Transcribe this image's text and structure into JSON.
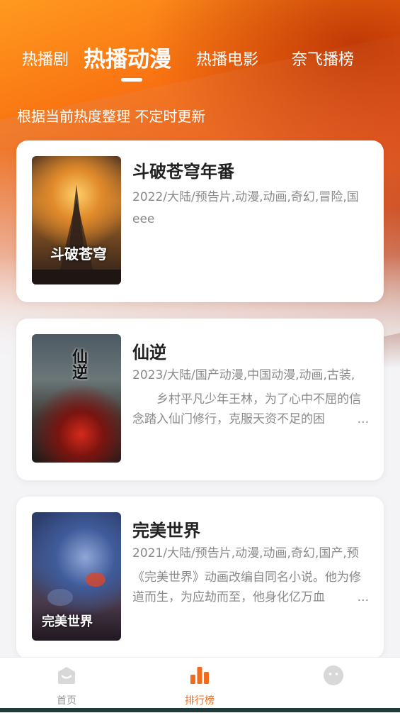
{
  "tabs": [
    {
      "label": "热播剧",
      "active": false
    },
    {
      "label": "热播动漫",
      "active": true
    },
    {
      "label": "热播电影",
      "active": false
    },
    {
      "label": "奈飞播榜",
      "active": false
    }
  ],
  "subtitle": "根据当前热度整理 不定时更新",
  "cards": [
    {
      "title": "斗破苍穹年番",
      "meta": "2022/大陆/预告片,动漫,动画,奇幻,冒险,国eee",
      "description": "",
      "poster_text": "斗破苍穹"
    },
    {
      "title": "仙逆",
      "meta": "2023/大陆/国产动漫,中国动漫,动画,古装,",
      "description": "　　乡村平凡少年王林，为了心中不屈的信念踏入仙门修行，克服天资不足的困",
      "ellipsis": "...",
      "poster_text": "仙逆"
    },
    {
      "title": "完美世界",
      "meta": "2021/大陆/预告片,动漫,动画,奇幻,国产,预",
      "description": "《完美世界》动画改编自同名小说。他为修道而生，为应劫而至，他身化亿万血",
      "ellipsis": "...",
      "poster_text": "完美世界"
    }
  ],
  "bottom_nav": [
    {
      "label": "首页",
      "icon": "home-icon",
      "active": false
    },
    {
      "label": "排行榜",
      "icon": "ranking-icon",
      "active": true
    },
    {
      "label": "",
      "icon": "profile-icon",
      "active": false
    }
  ],
  "colors": {
    "accent": "#f26a1b",
    "hero_orange": "#f86e10"
  }
}
